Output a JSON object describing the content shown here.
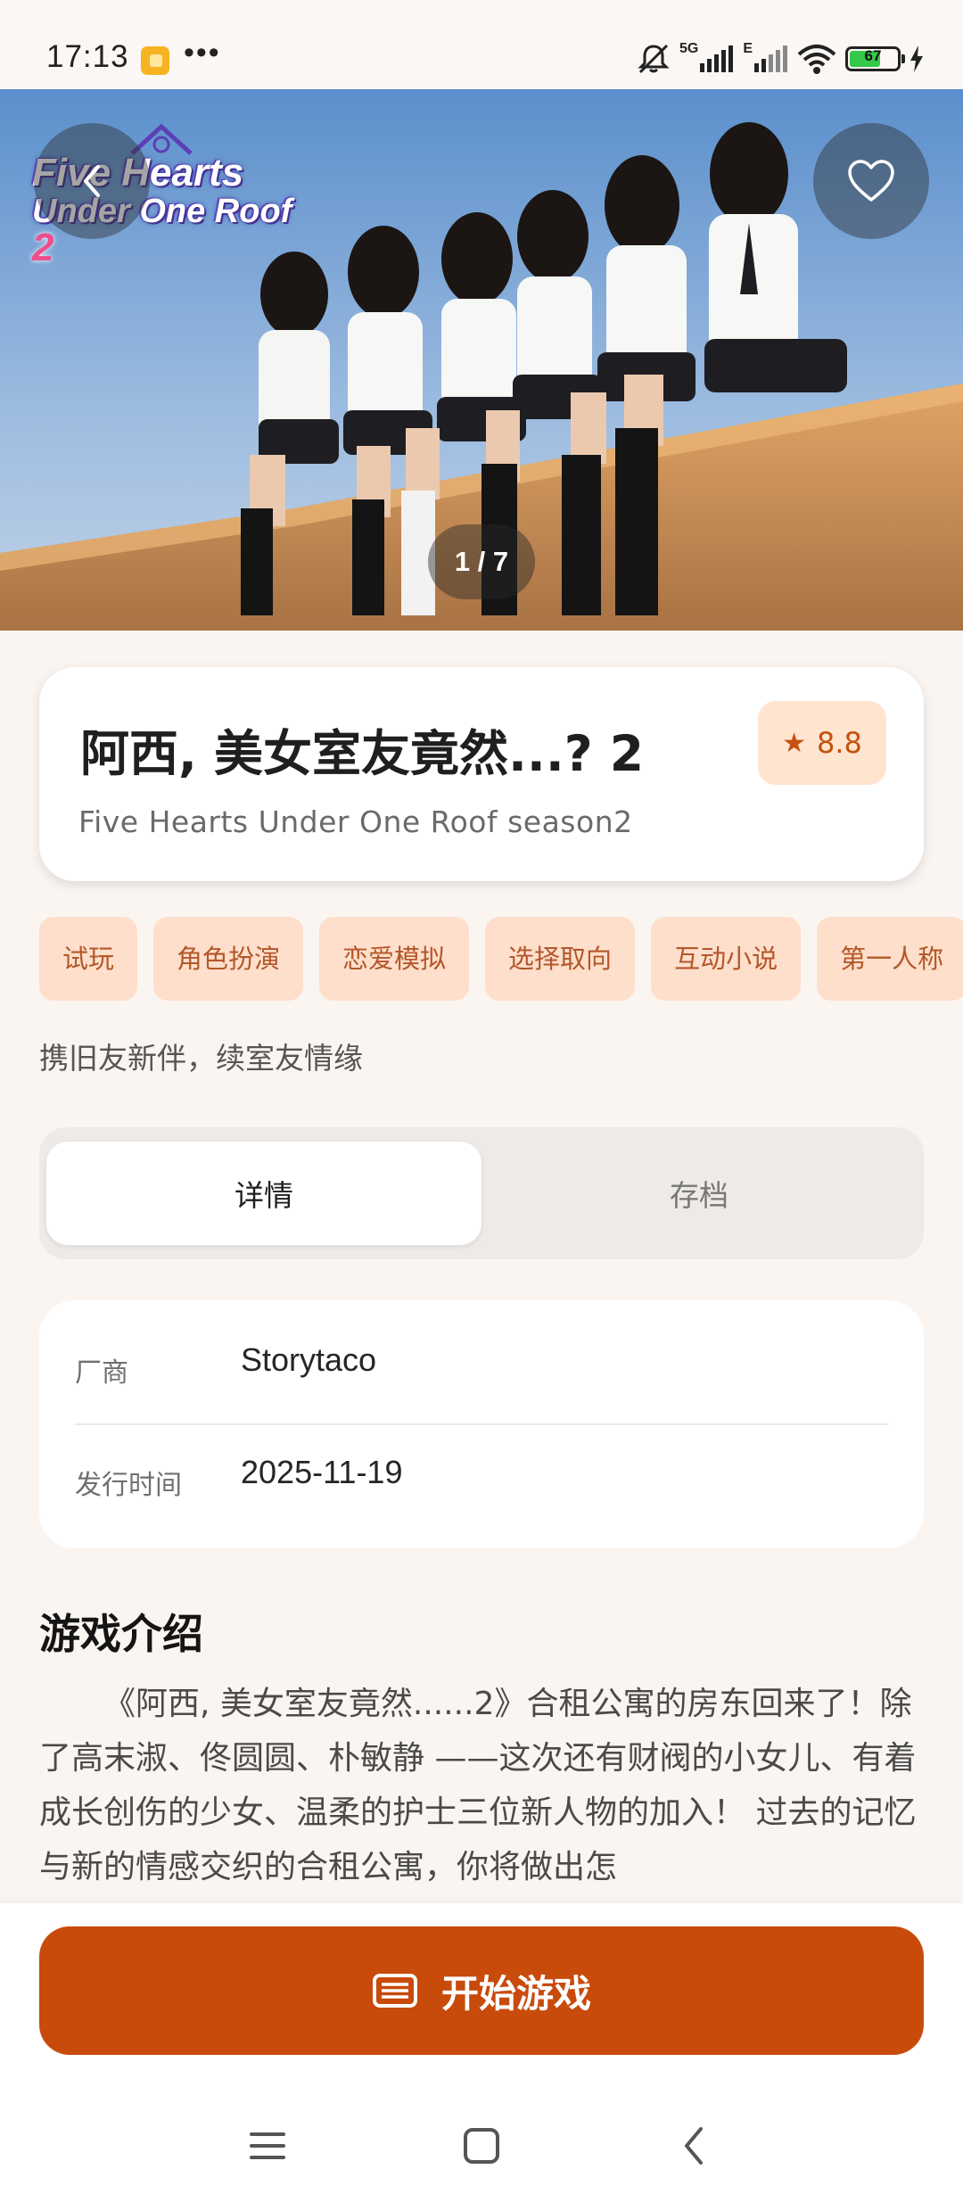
{
  "status_bar": {
    "time": "17:13",
    "dots": "•••",
    "network_label_1": "5G",
    "network_label_2": "E",
    "battery": "67",
    "battery_level": 0.67,
    "icons": [
      "app-notification-icon",
      "mute-icon",
      "signal-icon",
      "wifi-icon",
      "battery-icon",
      "charging-icon"
    ]
  },
  "hero": {
    "logo_line1": "Five Hearts",
    "logo_line2": "Under One Roof",
    "logo_number": "2",
    "page_indicator": "1 / 7",
    "current_page": 1,
    "total_pages": 7,
    "sky_color": "#6A9BD3",
    "wall_color": "#C98F55"
  },
  "game": {
    "title": "阿西, 美女室友竟然...? 2",
    "subtitle": "Five Hearts Under One Roof season2",
    "rating": "8.8",
    "rating_icon": "star-icon"
  },
  "tags": [
    "试玩",
    "角色扮演",
    "恋爱模拟",
    "选择取向",
    "互动小说",
    "第一人称"
  ],
  "tagline": "携旧友新伴，续室友情缘",
  "tabs": {
    "details": "详情",
    "saves": "存档",
    "active": "details"
  },
  "info": {
    "publisher_label": "厂商",
    "publisher_value": "Storytaco",
    "release_label": "发行时间",
    "release_value": "2025-11-19"
  },
  "intro": {
    "heading": "游戏介绍",
    "text": "《阿西, 美女室友竟然......2》合租公寓的房东回来了！除了高末淑、佟圆圆、朴敏静 ——这次还有财阀的小女儿、有着成长创伤的少女、温柔的护士三位新人物的加入！ 过去的记忆与新的情感交织的合租公寓，你将做出怎"
  },
  "actions": {
    "start_game": "开始游戏",
    "start_icon": "list-icon",
    "accent_color": "#C84B0C"
  },
  "nav": {
    "menu_icon": "menu-icon",
    "home_icon": "home-icon",
    "back_icon": "back-icon"
  }
}
